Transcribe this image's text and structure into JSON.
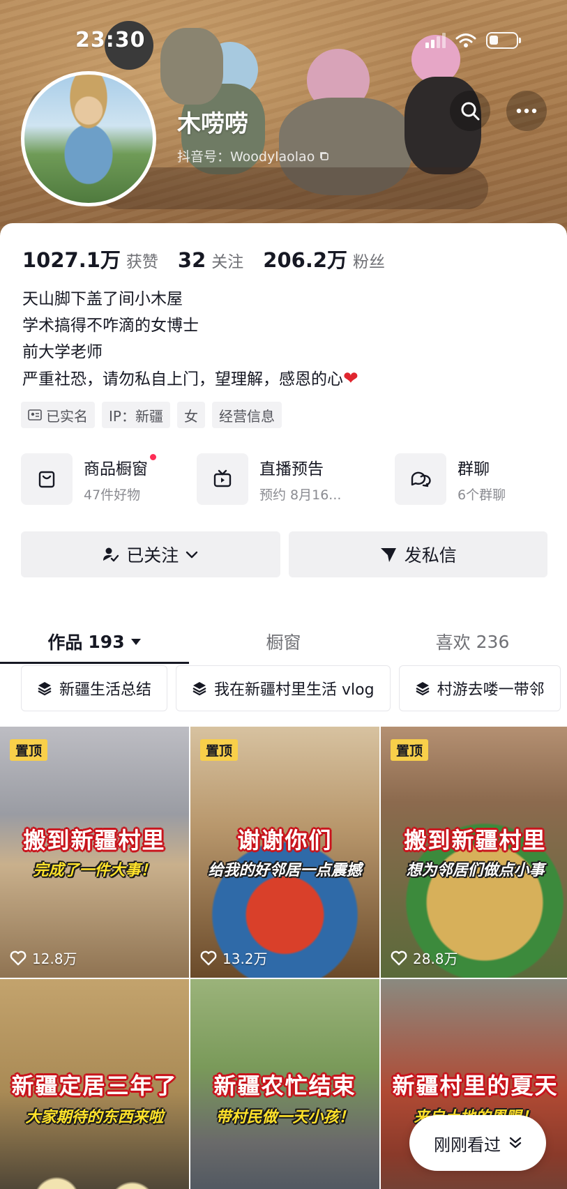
{
  "status_bar": {
    "time": "23:30"
  },
  "profile": {
    "nickname": "木唠唠",
    "douyin_id": "抖音号：Woodylaolao"
  },
  "stats": [
    {
      "num": "1027.1万",
      "label": "获赞"
    },
    {
      "num": "32",
      "label": "关注"
    },
    {
      "num": "206.2万",
      "label": "粉丝"
    }
  ],
  "bio": {
    "line1": "天山脚下盖了间小木屋",
    "line2": "学术搞得不咋滴的女博士",
    "line3": "前大学老师",
    "line4": "严重社恐，请勿私自上门，望理解，感恩的心"
  },
  "tags": [
    "已实名",
    "IP：新疆",
    "女",
    "经营信息"
  ],
  "services": [
    {
      "title": "商品橱窗",
      "sub": "47件好物",
      "icon": "shop-bag-icon"
    },
    {
      "title": "直播预告",
      "sub": "预约 8月16...",
      "icon": "tv-icon"
    },
    {
      "title": "群聊",
      "sub": "6个群聊",
      "icon": "chat-bubbles-icon"
    }
  ],
  "actions": {
    "follow": "已关注",
    "message": "发私信"
  },
  "tabs": [
    {
      "label": "作品",
      "count": "193"
    },
    {
      "label": "橱窗",
      "count": ""
    },
    {
      "label": "喜欢",
      "count": "236"
    }
  ],
  "collections": [
    "新疆生活总结",
    "我在新疆村里生活 vlog",
    "村游去喽一带邻"
  ],
  "videos": [
    {
      "pinned": "置顶",
      "title": "搬到新疆村里",
      "subtitle": "完成了一件大事！",
      "likes": "12.8万"
    },
    {
      "pinned": "置顶",
      "title": "谢谢你们",
      "subtitle": "给我的好邻居一点震撼",
      "likes": "13.2万"
    },
    {
      "pinned": "置顶",
      "title": "搬到新疆村里",
      "subtitle": "想为邻居们做点小事",
      "likes": "28.8万"
    },
    {
      "pinned": "",
      "title": "新疆定居三年了",
      "subtitle": "大家期待的东西来啦",
      "likes": ""
    },
    {
      "pinned": "",
      "title": "新疆农忙结束",
      "subtitle": "带村民做一天小孩！",
      "likes": ""
    },
    {
      "pinned": "",
      "title": "新疆村里的夏天",
      "subtitle": "来自土地的恩赐！",
      "likes": ""
    }
  ],
  "recent_button": "刚刚看过",
  "colors": {
    "accent_red": "#fe2c55",
    "caption_red": "#c8141c",
    "pin_yellow": "#f8cf4a"
  }
}
